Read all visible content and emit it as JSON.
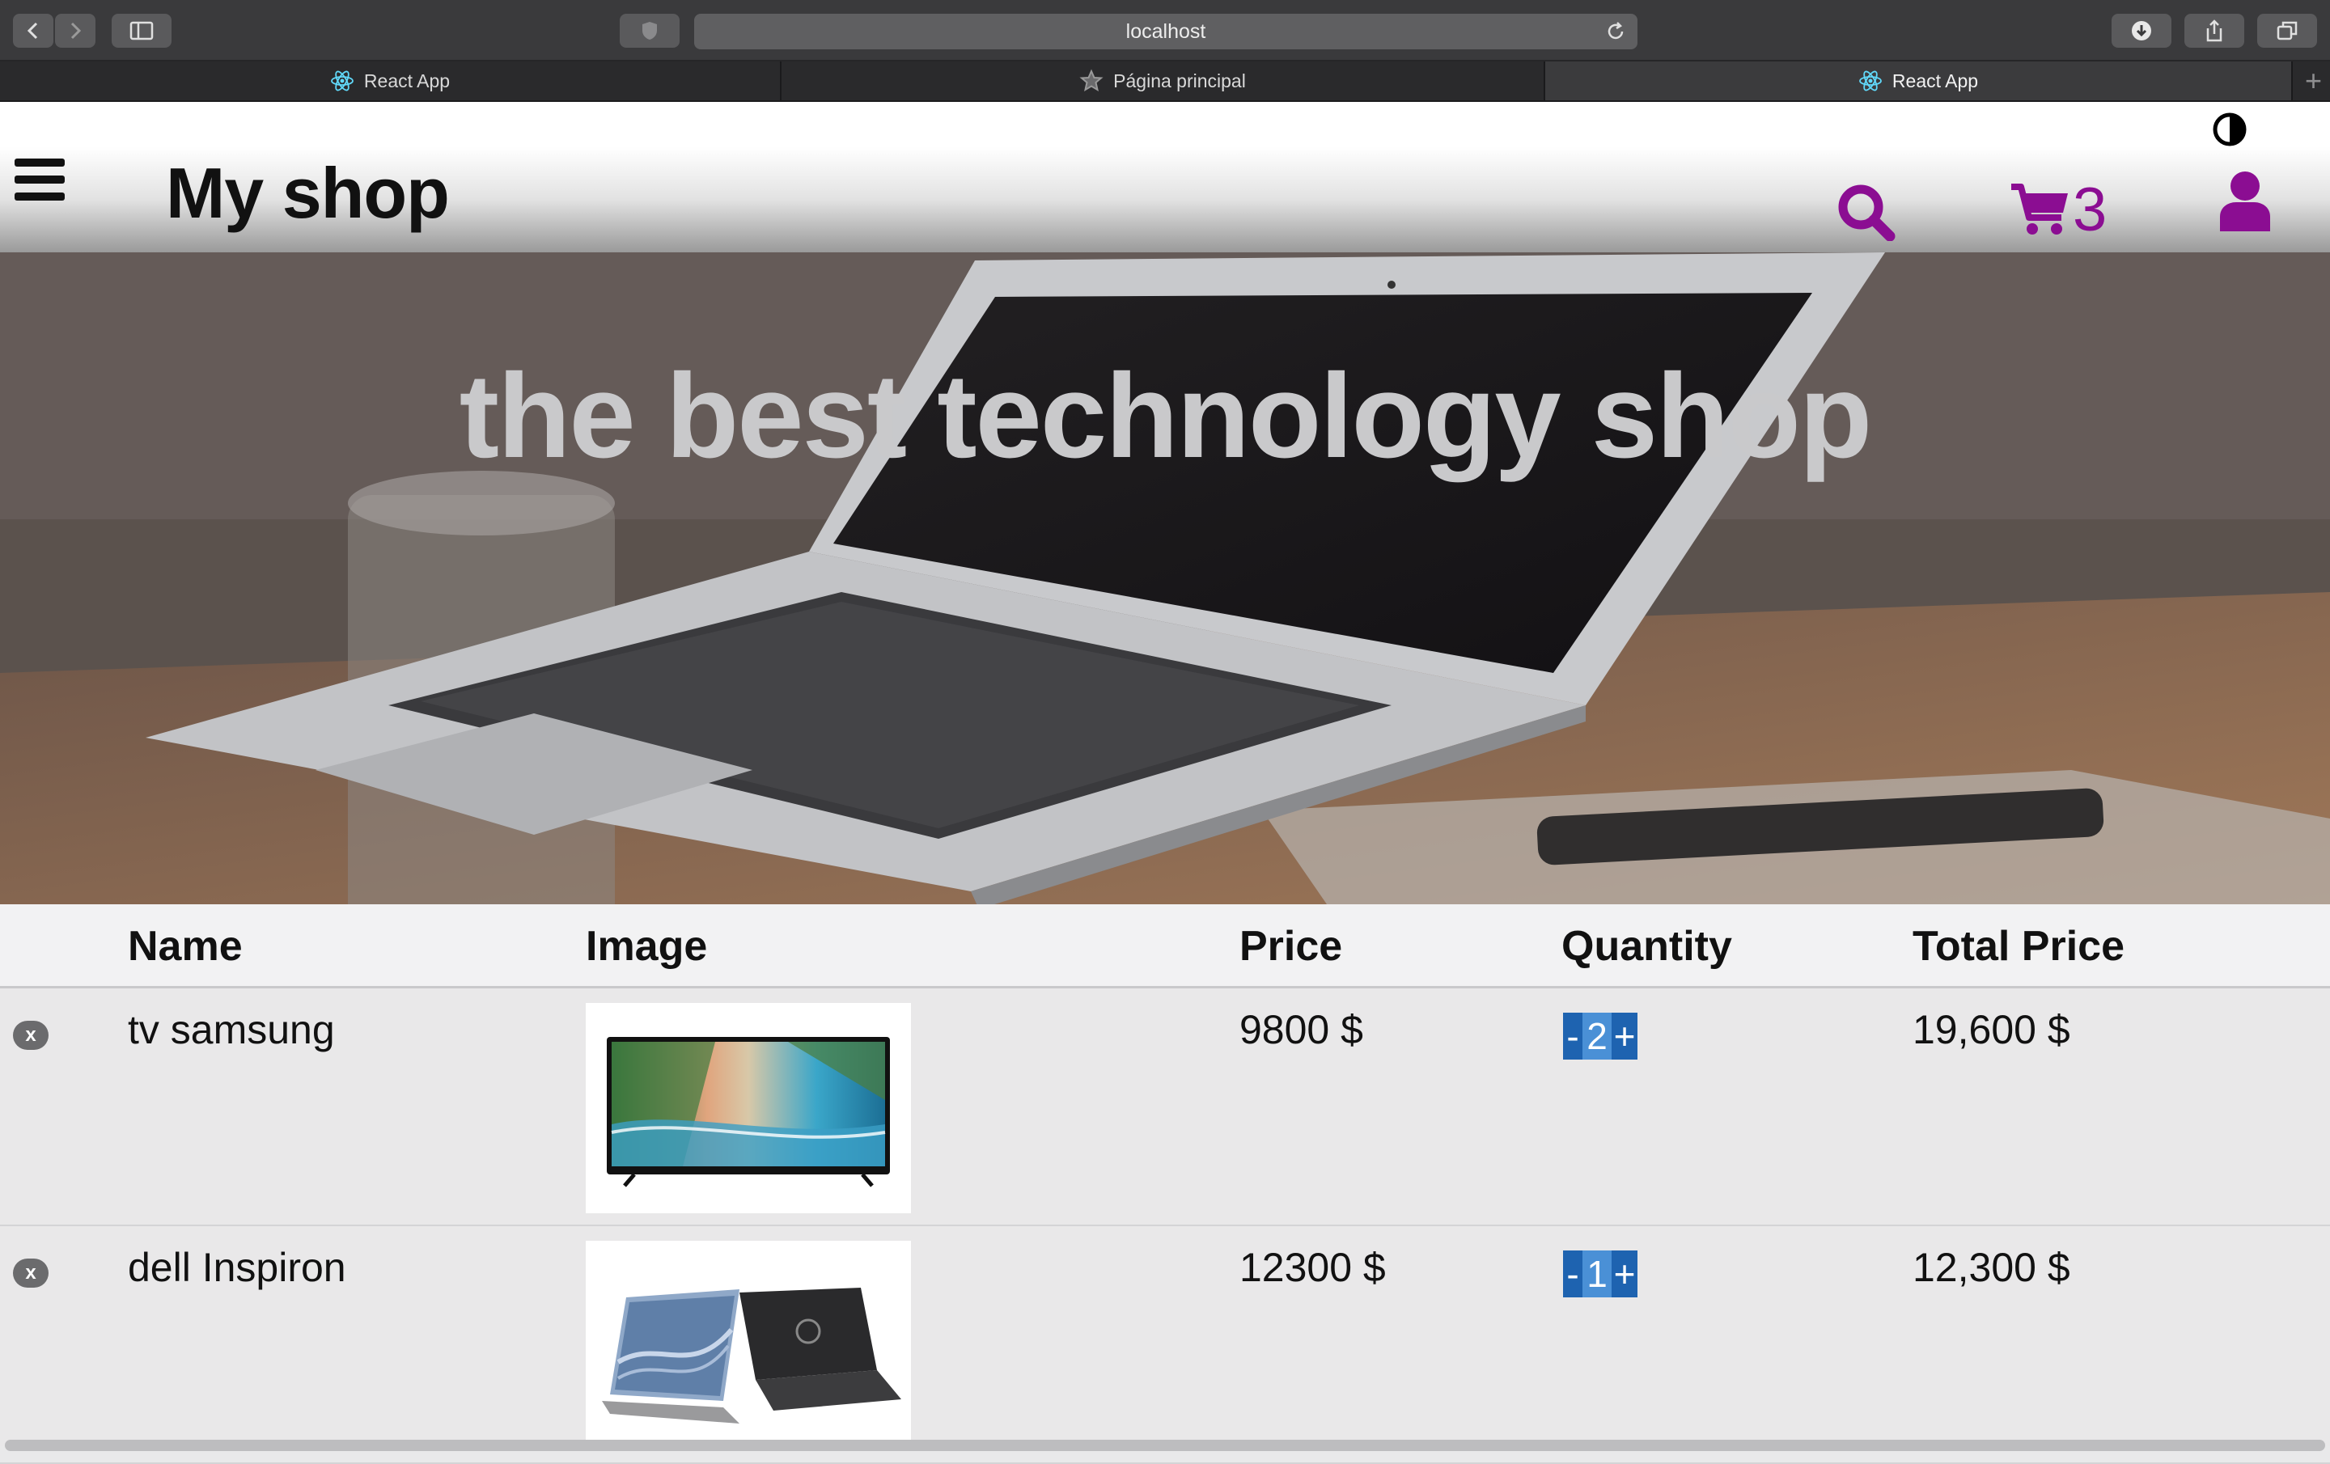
{
  "browser": {
    "url": "localhost",
    "tabs": [
      {
        "label": "React App",
        "icon": "react-icon",
        "active": false
      },
      {
        "label": "Página principal",
        "icon": "star-icon",
        "active": false
      },
      {
        "label": "React App",
        "icon": "react-icon",
        "active": true
      }
    ],
    "new_tab_label": "+"
  },
  "header": {
    "brand": "My shop",
    "cart_count": "3",
    "accent_color": "#8b0d92",
    "icons": [
      "menu-icon",
      "contrast-icon",
      "search-icon",
      "cart-icon",
      "user-icon"
    ]
  },
  "hero": {
    "title": "the best technology shop"
  },
  "cart_table": {
    "columns": [
      "Name",
      "Image",
      "Price",
      "Quantity",
      "Total Price"
    ],
    "remove_label": "x",
    "qty_minus": "-",
    "qty_plus": "+",
    "rows": [
      {
        "name": "tv samsung",
        "image": "tv-image",
        "price": "9800 $",
        "quantity": "2",
        "total": "19,600 $"
      },
      {
        "name": "dell Inspiron",
        "image": "laptop-image",
        "price": "12300 $",
        "quantity": "1",
        "total": "12,300 $"
      }
    ]
  }
}
